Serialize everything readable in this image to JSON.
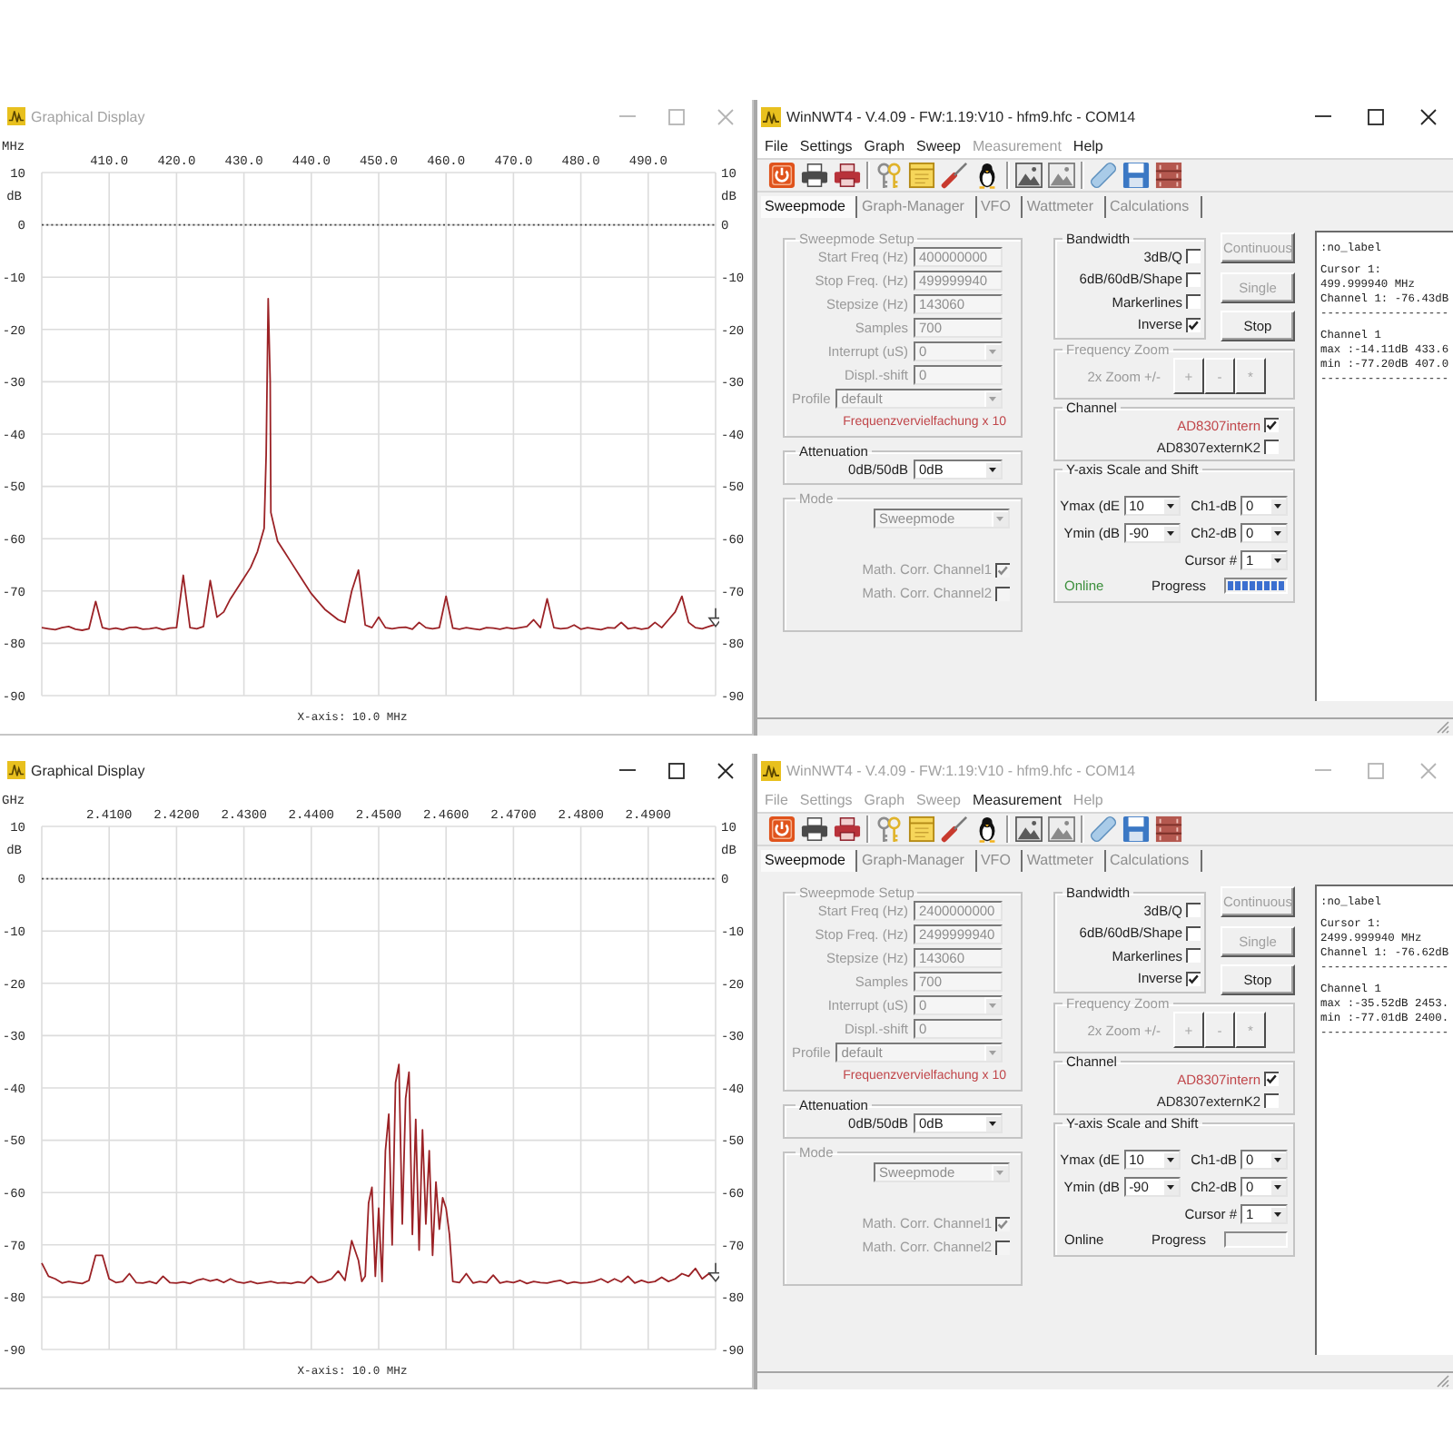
{
  "views": [
    {
      "graph_window": {
        "title": "Graphical Display",
        "active": false,
        "chart_data": {
          "type": "line",
          "xlabel": "MHz",
          "ylabel": "dB",
          "grid": true,
          "xlim": [
            400,
            500
          ],
          "ylim": [
            -90,
            10
          ],
          "xticks": [
            {
              "value": 410,
              "label": "410.0"
            },
            {
              "value": 420,
              "label": "420.0"
            },
            {
              "value": 430,
              "label": "430.0"
            },
            {
              "value": 440,
              "label": "440.0"
            },
            {
              "value": 450,
              "label": "450.0"
            },
            {
              "value": 460,
              "label": "460.0"
            },
            {
              "value": 470,
              "label": "470.0"
            },
            {
              "value": 480,
              "label": "480.0"
            },
            {
              "value": 490,
              "label": "490.0"
            }
          ],
          "yticks": [
            10,
            0,
            -10,
            -20,
            -30,
            -40,
            -50,
            -60,
            -70,
            -80,
            -90
          ],
          "ref_lines": [
            {
              "axis": "y",
              "value": 0
            }
          ],
          "x": [
            400,
            401,
            402,
            403,
            404,
            405,
            406,
            407,
            408,
            409,
            410,
            411,
            412,
            413,
            414,
            415,
            416,
            417,
            418,
            419,
            420,
            421,
            422,
            423,
            424,
            425,
            426,
            427,
            428,
            429,
            430,
            431,
            432,
            433,
            433.3,
            433.6,
            433.9,
            434,
            435,
            436,
            437,
            438,
            439,
            440,
            441,
            442,
            443,
            444,
            445,
            446,
            447,
            448,
            449,
            450,
            451,
            452,
            453,
            454,
            455,
            456,
            457,
            458,
            459,
            460,
            461,
            462,
            463,
            464,
            465,
            466,
            467,
            468,
            469,
            470,
            471,
            472,
            473,
            474,
            475,
            476,
            477,
            478,
            479,
            480,
            481,
            482,
            483,
            484,
            485,
            486,
            487,
            488,
            489,
            490,
            491,
            492,
            493,
            494,
            495,
            496,
            497,
            498,
            499,
            500
          ],
          "series": [
            {
              "color": "#9b2226",
              "values": [
                -77,
                -77.2,
                -77.4,
                -77,
                -76.8,
                -77.3,
                -77.5,
                -77.2,
                -72,
                -77,
                -77.3,
                -77.1,
                -77.4,
                -77,
                -76.9,
                -77.3,
                -77.2,
                -77,
                -77.4,
                -77.1,
                -77,
                -67,
                -77,
                -77.2,
                -76.8,
                -68,
                -75,
                -74,
                -71.5,
                -69.5,
                -67.5,
                -65.5,
                -62.5,
                -58,
                -44,
                -14.1,
                -30,
                -55,
                -60.5,
                -62.5,
                -64.5,
                -66.5,
                -68.5,
                -70.5,
                -72,
                -73.5,
                -74.5,
                -75.5,
                -76,
                -70,
                -66,
                -76.5,
                -77,
                -75,
                -77,
                -77.2,
                -77,
                -76.9,
                -77.3,
                -76,
                -77,
                -77.2,
                -77,
                -71,
                -77.1,
                -77.3,
                -77,
                -77.2,
                -77.4,
                -77,
                -77.1,
                -77.3,
                -77,
                -77.2,
                -77,
                -76.8,
                -75.5,
                -77,
                -71.5,
                -77,
                -77.2,
                -77.1,
                -76.5,
                -77.3,
                -77,
                -77.2,
                -77.4,
                -77,
                -77.1,
                -76,
                -77.2,
                -77,
                -77.3,
                -77.1,
                -76,
                -77,
                -75.5,
                -74,
                -71,
                -76,
                -77,
                -77.2,
                -76.8,
                -76.4
              ]
            }
          ]
        },
        "right_axis": {
          "label": "dB",
          "ticks": [
            "10",
            "0",
            "-10",
            "-20",
            "-30",
            "-40",
            "-50",
            "-60",
            "-70",
            "-80",
            "-90"
          ]
        },
        "scale_caption": "X-axis: 10.0 MHz"
      },
      "control_window": {
        "title": "WinNWT4 - V.4.09 - FW:1.19:V10 - hfm9.hfc - COM14",
        "active": true,
        "menu": [
          {
            "label": "File",
            "disabled": false
          },
          {
            "label": "Settings",
            "disabled": false
          },
          {
            "label": "Graph",
            "disabled": false
          },
          {
            "label": "Sweep",
            "disabled": false
          },
          {
            "label": "Measurement",
            "disabled": true
          },
          {
            "label": "Help",
            "disabled": false
          }
        ],
        "tabs": [
          {
            "label": "Sweepmode",
            "selected": true
          },
          {
            "label": "Graph-Manager",
            "selected": false
          },
          {
            "label": "VFO",
            "selected": false
          },
          {
            "label": "Wattmeter",
            "selected": false
          },
          {
            "label": "Calculations",
            "selected": false
          }
        ],
        "sweep_setup": {
          "title": "Sweepmode Setup",
          "disabled": true,
          "fields": [
            {
              "kind": "text",
              "label": "Start Freq (Hz)",
              "value": "400000000"
            },
            {
              "kind": "text",
              "label": "Stop Freq. (Hz)",
              "value": "499999940"
            },
            {
              "kind": "text",
              "label": "Stepsize (Hz)",
              "value": "143060"
            },
            {
              "kind": "text",
              "label": "Samples",
              "value": "700"
            },
            {
              "kind": "dropdown",
              "label": "Interrupt (uS)",
              "value": "0"
            },
            {
              "kind": "text",
              "label": "Displ.-shift",
              "value": "0"
            }
          ],
          "profile": {
            "label": "Profile",
            "value": "default"
          },
          "note": "Frequenzvervielfachung x 10"
        },
        "attenuation": {
          "title": "Attenuation",
          "label": "0dB/50dB",
          "value": "0dB"
        },
        "mode": {
          "title": "Mode",
          "disabled": true,
          "value": "Sweepmode",
          "options": [
            {
              "label": "Math. Corr. Channel1",
              "checked": true
            },
            {
              "label": "Math. Corr. Channel2",
              "checked": false
            }
          ]
        },
        "bandwidth": {
          "title": "Bandwidth",
          "options": [
            {
              "label": "3dB/Q",
              "checked": false
            },
            {
              "label": "6dB/60dB/Shape",
              "checked": false
            },
            {
              "label": "Markerlines",
              "checked": false
            },
            {
              "label": "Inverse",
              "checked": true
            }
          ]
        },
        "sweep_buttons": [
          {
            "label": "Continuous",
            "disabled": true
          },
          {
            "label": "Single",
            "disabled": true
          },
          {
            "label": "Stop",
            "disabled": false
          }
        ],
        "frequency_zoom": {
          "title": "Frequency Zoom",
          "disabled": true,
          "label": "2x Zoom +/-",
          "buttons": [
            "+",
            "-",
            "*"
          ]
        },
        "channel": {
          "title": "Channel",
          "options": [
            {
              "label": "AD8307intern",
              "checked": true,
              "color": "#c0464a"
            },
            {
              "label": "AD8307externK2",
              "checked": false,
              "color": "#2a2a2a"
            }
          ]
        },
        "y_axis": {
          "title": "Y-axis Scale and Shift",
          "fields": [
            {
              "label": "Ymax (dE",
              "value": "10"
            },
            {
              "label": "Ch1-dB",
              "value": "0"
            },
            {
              "label": "Ymin (dB",
              "value": "-90"
            },
            {
              "label": "Ch2-dB",
              "value": "0"
            }
          ],
          "cursor": {
            "label": "Cursor #",
            "value": "1"
          },
          "status": {
            "label": "Online",
            "on": true
          },
          "progress": {
            "label": "Progress",
            "level": 1
          }
        },
        "readout": {
          "blocks": [
            [
              ":no_label"
            ],
            [
              "Cursor 1:",
              "499.999940 MHz",
              "Channel 1: -76.43dB",
              "-------------------"
            ],
            [
              "Channel 1",
              "max :-14.11dB 433.6",
              "min :-77.20dB 407.0",
              "-------------------"
            ]
          ]
        }
      }
    },
    {
      "graph_window": {
        "title": "Graphical Display",
        "active": true,
        "chart_data": {
          "type": "line",
          "xlabel": "GHz",
          "ylabel": "dB",
          "grid": true,
          "xlim": [
            2.4,
            2.5
          ],
          "ylim": [
            -90,
            10
          ],
          "xticks": [
            {
              "value": 2.41,
              "label": "2.4100"
            },
            {
              "value": 2.42,
              "label": "2.4200"
            },
            {
              "value": 2.43,
              "label": "2.4300"
            },
            {
              "value": 2.44,
              "label": "2.4400"
            },
            {
              "value": 2.45,
              "label": "2.4500"
            },
            {
              "value": 2.46,
              "label": "2.4600"
            },
            {
              "value": 2.47,
              "label": "2.4700"
            },
            {
              "value": 2.48,
              "label": "2.4800"
            },
            {
              "value": 2.49,
              "label": "2.4900"
            }
          ],
          "yticks": [
            10,
            0,
            -10,
            -20,
            -30,
            -40,
            -50,
            -60,
            -70,
            -80,
            -90
          ],
          "ref_lines": [
            {
              "axis": "y",
              "value": 0
            }
          ],
          "x": [
            2.4,
            2.401,
            2.402,
            2.403,
            2.404,
            2.405,
            2.406,
            2.407,
            2.408,
            2.409,
            2.41,
            2.411,
            2.412,
            2.413,
            2.414,
            2.415,
            2.416,
            2.417,
            2.418,
            2.419,
            2.42,
            2.421,
            2.422,
            2.423,
            2.424,
            2.425,
            2.426,
            2.427,
            2.428,
            2.429,
            2.43,
            2.431,
            2.432,
            2.433,
            2.434,
            2.435,
            2.436,
            2.437,
            2.438,
            2.439,
            2.44,
            2.441,
            2.442,
            2.443,
            2.444,
            2.445,
            2.446,
            2.447,
            2.4475,
            2.448,
            2.4485,
            2.449,
            2.4495,
            2.45,
            2.4505,
            2.451,
            2.4515,
            2.452,
            2.4525,
            2.453,
            2.4535,
            2.454,
            2.4545,
            2.455,
            2.4555,
            2.456,
            2.4565,
            2.457,
            2.4575,
            2.458,
            2.4585,
            2.459,
            2.4595,
            2.46,
            2.4605,
            2.461,
            2.462,
            2.463,
            2.464,
            2.465,
            2.466,
            2.467,
            2.468,
            2.469,
            2.47,
            2.471,
            2.472,
            2.473,
            2.474,
            2.475,
            2.476,
            2.477,
            2.478,
            2.479,
            2.48,
            2.481,
            2.482,
            2.483,
            2.484,
            2.485,
            2.486,
            2.487,
            2.488,
            2.489,
            2.49,
            2.491,
            2.492,
            2.493,
            2.494,
            2.495,
            2.496,
            2.497,
            2.498,
            2.499,
            2.5
          ],
          "series": [
            {
              "color": "#9b2226",
              "values": [
                -73.5,
                -76,
                -76.5,
                -77.3,
                -77,
                -77.2,
                -77.4,
                -76.8,
                -72,
                -72,
                -76.5,
                -77.2,
                -77,
                -75.5,
                -77.2,
                -77.3,
                -77,
                -77.4,
                -76,
                -77.2,
                -77.3,
                -77.1,
                -77.4,
                -76.8,
                -76.5,
                -76.9,
                -76.6,
                -77.2,
                -76.5,
                -77.1,
                -77.3,
                -77,
                -77.4,
                -77.2,
                -77,
                -77.3,
                -77.2,
                -77.4,
                -77.1,
                -77.3,
                -76,
                -77.2,
                -77,
                -76.5,
                -75,
                -76.8,
                -69.2,
                -73,
                -77,
                -76,
                -62,
                -59,
                -76,
                -63,
                -77,
                -52,
                -45,
                -70,
                -39,
                -35.5,
                -66,
                -42,
                -37,
                -68,
                -46,
                -71,
                -48,
                -66,
                -52,
                -72,
                -58,
                -67,
                -61,
                -63,
                -68,
                -77,
                -77.2,
                -75.5,
                -77.3,
                -77,
                -77.2,
                -75.8,
                -77.3,
                -77,
                -77.2,
                -76.8,
                -77.4,
                -77,
                -77.2,
                -77.3,
                -77,
                -76.8,
                -77.4,
                -77.1,
                -77.3,
                -77.2,
                -77,
                -76.5,
                -77.2,
                -76.5,
                -77.1,
                -76,
                -77.3,
                -76.8,
                -77.2,
                -77,
                -76.2,
                -77,
                -76.5,
                -75.5,
                -76,
                -74.5,
                -76.5,
                -75.5,
                -76.6
              ]
            }
          ]
        },
        "right_axis": {
          "label": "dB",
          "ticks": [
            "10",
            "0",
            "-10",
            "-20",
            "-30",
            "-40",
            "-50",
            "-60",
            "-70",
            "-80",
            "-90"
          ]
        },
        "scale_caption": "X-axis: 10.0 MHz"
      },
      "control_window": {
        "title": "WinNWT4 - V.4.09 - FW:1.19:V10 - hfm9.hfc - COM14",
        "active": false,
        "menu": [
          {
            "label": "File",
            "disabled": true
          },
          {
            "label": "Settings",
            "disabled": true
          },
          {
            "label": "Graph",
            "disabled": true
          },
          {
            "label": "Sweep",
            "disabled": true
          },
          {
            "label": "Measurement",
            "disabled": false
          },
          {
            "label": "Help",
            "disabled": true
          }
        ],
        "tabs": [
          {
            "label": "Sweepmode",
            "selected": true
          },
          {
            "label": "Graph-Manager",
            "selected": false
          },
          {
            "label": "VFO",
            "selected": false
          },
          {
            "label": "Wattmeter",
            "selected": false
          },
          {
            "label": "Calculations",
            "selected": false
          }
        ],
        "sweep_setup": {
          "title": "Sweepmode Setup",
          "disabled": true,
          "fields": [
            {
              "kind": "text",
              "label": "Start Freq (Hz)",
              "value": "2400000000"
            },
            {
              "kind": "text",
              "label": "Stop Freq. (Hz)",
              "value": "2499999940"
            },
            {
              "kind": "text",
              "label": "Stepsize (Hz)",
              "value": "143060"
            },
            {
              "kind": "text",
              "label": "Samples",
              "value": "700"
            },
            {
              "kind": "dropdown",
              "label": "Interrupt (uS)",
              "value": "0"
            },
            {
              "kind": "text",
              "label": "Displ.-shift",
              "value": "0"
            }
          ],
          "profile": {
            "label": "Profile",
            "value": "default"
          },
          "note": "Frequenzvervielfachung x 10"
        },
        "attenuation": {
          "title": "Attenuation",
          "label": "0dB/50dB",
          "value": "0dB"
        },
        "mode": {
          "title": "Mode",
          "disabled": true,
          "value": "Sweepmode",
          "options": [
            {
              "label": "Math. Corr. Channel1",
              "checked": true
            },
            {
              "label": "Math. Corr. Channel2",
              "checked": false
            }
          ]
        },
        "bandwidth": {
          "title": "Bandwidth",
          "options": [
            {
              "label": "3dB/Q",
              "checked": false
            },
            {
              "label": "6dB/60dB/Shape",
              "checked": false
            },
            {
              "label": "Markerlines",
              "checked": false
            },
            {
              "label": "Inverse",
              "checked": true
            }
          ]
        },
        "sweep_buttons": [
          {
            "label": "Continuous",
            "disabled": true
          },
          {
            "label": "Single",
            "disabled": true
          },
          {
            "label": "Stop",
            "disabled": false
          }
        ],
        "frequency_zoom": {
          "title": "Frequency Zoom",
          "disabled": true,
          "label": "2x Zoom +/-",
          "buttons": [
            "+",
            "-",
            "*"
          ]
        },
        "channel": {
          "title": "Channel",
          "options": [
            {
              "label": "AD8307intern",
              "checked": true,
              "color": "#c0464a"
            },
            {
              "label": "AD8307externK2",
              "checked": false,
              "color": "#2a2a2a"
            }
          ]
        },
        "y_axis": {
          "title": "Y-axis Scale and Shift",
          "fields": [
            {
              "label": "Ymax (dE",
              "value": "10"
            },
            {
              "label": "Ch1-dB",
              "value": "0"
            },
            {
              "label": "Ymin (dB",
              "value": "-90"
            },
            {
              "label": "Ch2-dB",
              "value": "0"
            }
          ],
          "cursor": {
            "label": "Cursor #",
            "value": "1"
          },
          "status": {
            "label": "Online",
            "on": false
          },
          "progress": {
            "label": "Progress",
            "level": 0
          }
        },
        "readout": {
          "blocks": [
            [
              ":no_label"
            ],
            [
              "Cursor 1:",
              "2499.999940 MHz",
              "Channel 1: -76.62dB",
              "-------------------"
            ],
            [
              "Channel 1",
              "max :-35.52dB 2453.",
              "min :-77.01dB 2400.",
              "-------------------"
            ]
          ]
        }
      }
    }
  ]
}
